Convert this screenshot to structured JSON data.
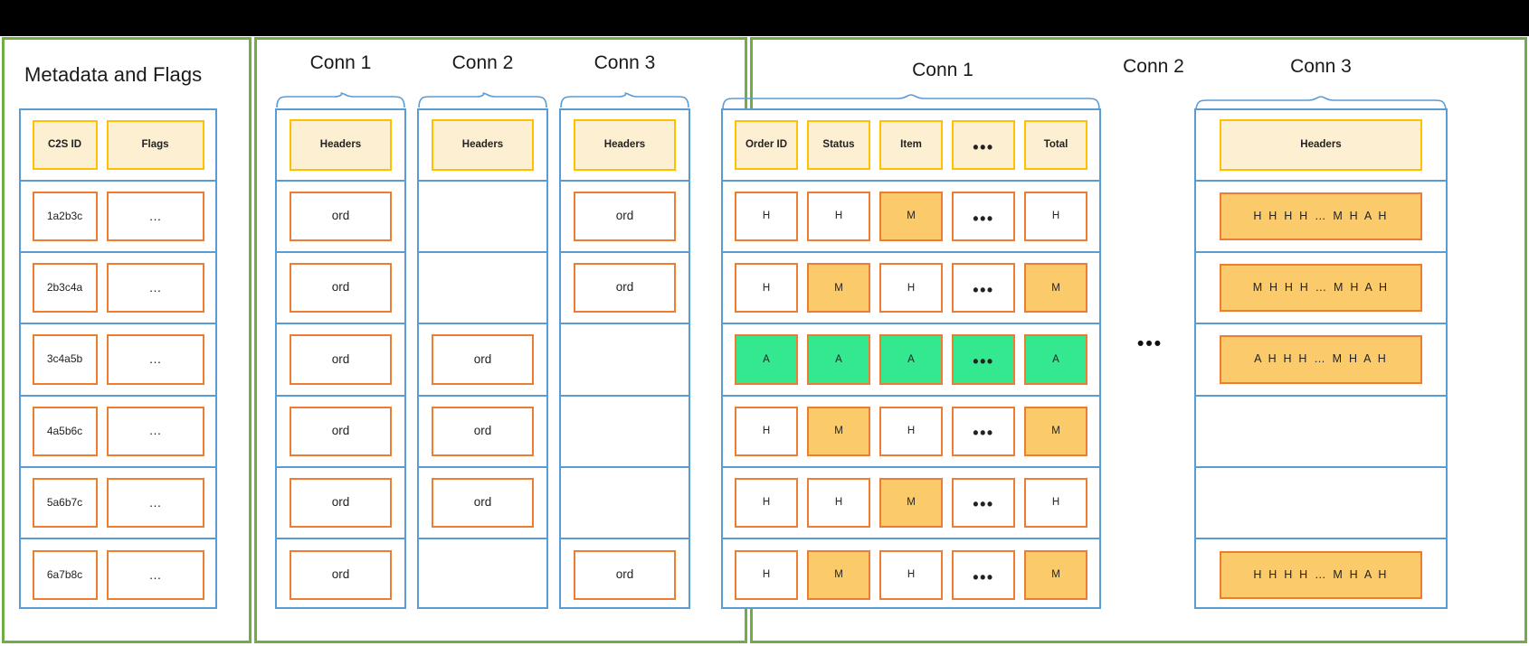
{
  "colors": {
    "frame_green": "#70AD47",
    "stack_blue": "#5B9BD5",
    "header_border": "#FFC000",
    "header_fill": "#FDEFD2",
    "data_border": "#ED7D31",
    "mutated_fill": "#FBCB6B",
    "aggregate_fill": "#33E88E",
    "top_bar": "#000000"
  },
  "left_panel": {
    "title": "Metadata and Flags",
    "headers": [
      "C2S ID",
      "Flags"
    ],
    "rows": [
      {
        "id": "1a2b3c",
        "flags": "…"
      },
      {
        "id": "2b3c4a",
        "flags": "…"
      },
      {
        "id": "3c4a5b",
        "flags": "…"
      },
      {
        "id": "4a5b6c",
        "flags": "…"
      },
      {
        "id": "5a6b7c",
        "flags": "…"
      },
      {
        "id": "6a7b8c",
        "flags": "…"
      }
    ]
  },
  "mid_panel": {
    "columns": [
      {
        "title": "Conn 1",
        "header": "Headers",
        "cells": [
          "ord",
          "ord",
          "ord",
          "ord",
          "ord",
          "ord"
        ]
      },
      {
        "title": "Conn 2",
        "header": "Headers",
        "cells": [
          "",
          "",
          "ord",
          "ord",
          "ord",
          ""
        ]
      },
      {
        "title": "Conn 3",
        "header": "Headers",
        "cells": [
          "ord",
          "ord",
          "",
          "",
          "",
          "ord"
        ]
      }
    ]
  },
  "right_panel": {
    "conn1": {
      "title": "Conn 1",
      "headers": [
        "Order ID",
        "Status",
        "Item",
        "•••",
        "Total"
      ],
      "rows": [
        {
          "cells": [
            "H",
            "H",
            "M",
            "•••",
            "H"
          ],
          "kinds": [
            "data",
            "data",
            "mut",
            "data",
            "data"
          ]
        },
        {
          "cells": [
            "H",
            "M",
            "H",
            "•••",
            "M"
          ],
          "kinds": [
            "data",
            "mut",
            "data",
            "data",
            "mut"
          ]
        },
        {
          "cells": [
            "A",
            "A",
            "A",
            "•••",
            "A"
          ],
          "kinds": [
            "agg",
            "agg",
            "agg",
            "agg",
            "agg"
          ]
        },
        {
          "cells": [
            "H",
            "M",
            "H",
            "•••",
            "M"
          ],
          "kinds": [
            "data",
            "mut",
            "data",
            "data",
            "mut"
          ]
        },
        {
          "cells": [
            "H",
            "H",
            "M",
            "•••",
            "H"
          ],
          "kinds": [
            "data",
            "data",
            "mut",
            "data",
            "data"
          ]
        },
        {
          "cells": [
            "H",
            "M",
            "H",
            "•••",
            "M"
          ],
          "kinds": [
            "data",
            "mut",
            "data",
            "data",
            "mut"
          ]
        }
      ]
    },
    "conn2": {
      "title": "Conn 2",
      "ellipsis": "•••"
    },
    "conn3": {
      "title": "Conn 3",
      "header": "Headers",
      "rows": [
        "H H H H … M H A H",
        "M H H H … M H A H",
        "A H H H … M H A H",
        "",
        "",
        "H H H H … M H A H"
      ]
    }
  }
}
